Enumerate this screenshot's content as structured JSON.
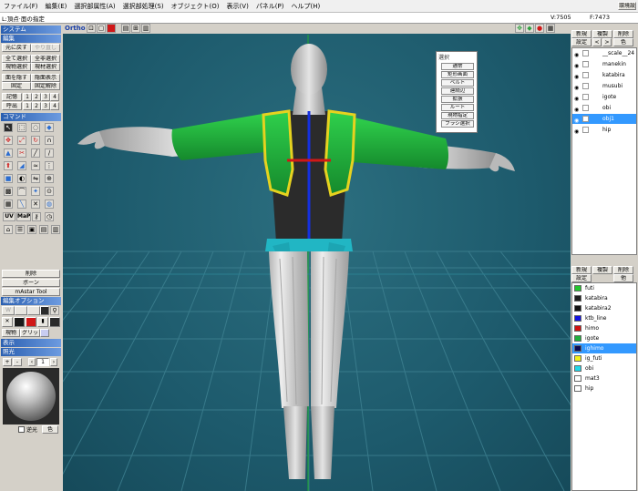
{
  "menubar": [
    "ファイル(F)",
    "編集(E)",
    "選択部属性(A)",
    "選択部処理(S)",
    "オブジェクト(O)",
    "表示(V)",
    "パネル(P)",
    "ヘルプ(H)"
  ],
  "status": {
    "mode": "L:頂点·面の指定",
    "vertices": "V:7505",
    "faces": "F:7473"
  },
  "left_panel": {
    "system_header": "システム",
    "edit_header": "編集",
    "undo": "元に戻す",
    "redo": "やり直し",
    "select_all": "全て選択",
    "invert_select": "全非選択",
    "material_select": "現物選択",
    "material_select2": "現材選択",
    "hide_face": "面を隠す",
    "show_hidden": "隠面表示",
    "fix": "固定",
    "unfix": "固定解除",
    "memory": "記憶",
    "recall": "呼出",
    "slots": [
      "1",
      "2",
      "3",
      "4"
    ],
    "command_header": "コマンド",
    "tool_labels": [
      "UV",
      "MaP"
    ],
    "delete": "削除",
    "bone": "ボーン",
    "mastar": "mAstar Tool",
    "edit_option_header": "編集オプション",
    "obj_opt": "現物",
    "grid_opt": "グリッド",
    "display_header": "表示",
    "lighting_header": "照光",
    "light_plus": "+",
    "light_minus": "-",
    "light_num": "1",
    "backlight": "逆光",
    "color": "色"
  },
  "viewport": {
    "ortho_label": "Ortho",
    "background": "#1e5e70",
    "figure_colors": {
      "skin": "#c9c9c9",
      "body": "#2b2b2b",
      "jacket": "#1fae3c",
      "trim": "#e6d21f",
      "belt": "#21b6c4",
      "pants": "#d8d8d8"
    }
  },
  "select_panel": {
    "title": "選択",
    "items": [
      "通常",
      "矩形画面",
      "ベルト",
      "連続辺",
      "拡張",
      "ルート",
      "現物指定",
      "ブラシ選択"
    ]
  },
  "object_panel": {
    "buttons": [
      "新規",
      "複製",
      "削除"
    ],
    "settings": "設定",
    "prev": "<",
    "next": ">",
    "color_btn": "色",
    "objects": [
      "__scale__24",
      "manekin",
      "katabira",
      "musubi",
      "igote",
      "obi",
      "obj1",
      "hip"
    ],
    "selected": "obj1"
  },
  "material_panel": {
    "buttons": [
      "新規",
      "複製",
      "削除"
    ],
    "settings": "設定",
    "material_btn": "他",
    "materials": [
      {
        "name": "futi",
        "color": "#22c52e"
      },
      {
        "name": "katabira",
        "color": "#1e1e1e"
      },
      {
        "name": "katabira2",
        "color": "#111111"
      },
      {
        "name": "ktb_line",
        "color": "#1010e0"
      },
      {
        "name": "himo",
        "color": "#d01010"
      },
      {
        "name": "igote",
        "color": "#1fae3c"
      },
      {
        "name": "ighimo",
        "color": "#0a0a50"
      },
      {
        "name": "ig_futi",
        "color": "#f2f01a"
      },
      {
        "name": "obi",
        "color": "#21d7e8"
      },
      {
        "name": "mat3",
        "color": "#ffffff"
      },
      {
        "name": "hip",
        "color": "#ffffff"
      }
    ],
    "selected": "ighimo"
  },
  "top_right_btn": "環境設"
}
